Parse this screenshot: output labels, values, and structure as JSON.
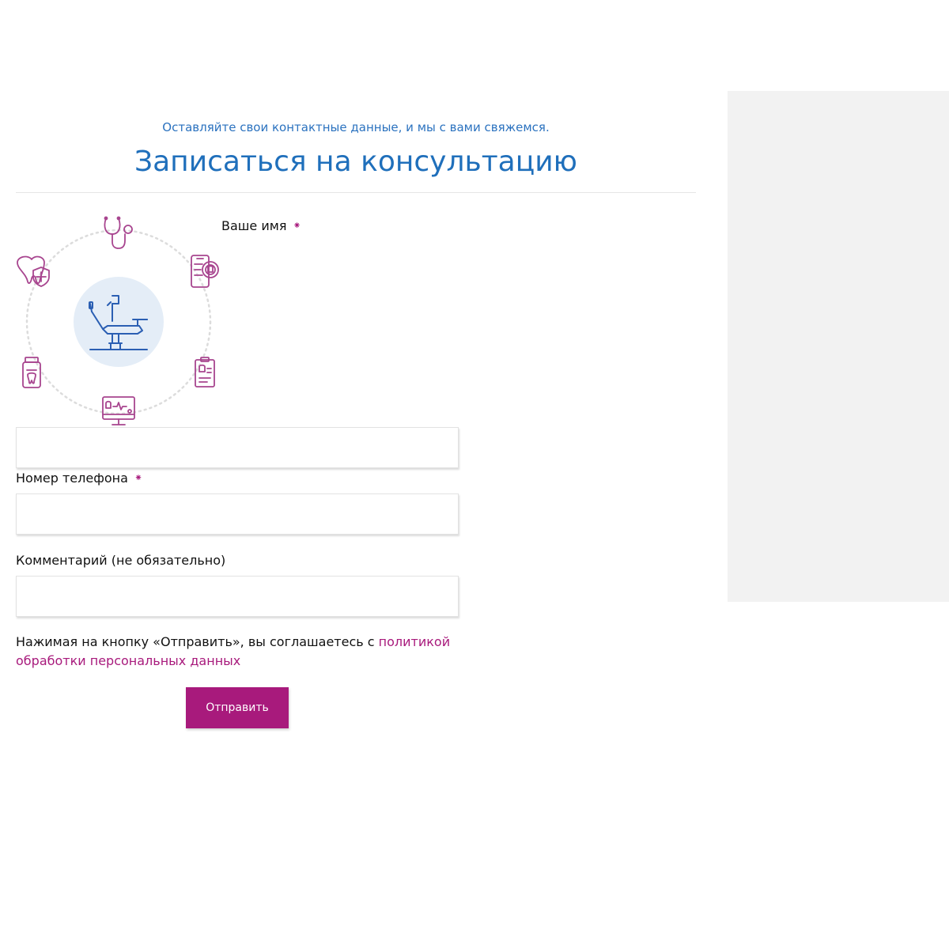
{
  "header": {
    "subtitle": "Оставляйте свои контактные данные, и мы с вами свяжемся.",
    "title": "Записаться на консультацию"
  },
  "form": {
    "name_label": "Ваше имя",
    "phone_label": "Номер телефона",
    "comment_label": "Комментарий (не обязательно)",
    "required_mark": "⁕",
    "name_value": "",
    "phone_value": "",
    "comment_value": "",
    "consent_text": "Нажимая на кнопку «Отправить», вы соглашаетесь с ",
    "consent_link": "политикой обработки персональных данных",
    "submit_label": "Отправить"
  },
  "illustration": {
    "center_icon": "dental-chair-icon",
    "orbit_icons": [
      "stethoscope-icon",
      "phone-tooth-icon",
      "dental-record-icon",
      "dental-monitor-icon",
      "medicine-jar-icon",
      "tooth-shield-icon"
    ]
  },
  "colors": {
    "accent_blue": "#1f6fbb",
    "accent_purple": "#a81a7c",
    "sidebar_bg": "#f2f2f2"
  }
}
